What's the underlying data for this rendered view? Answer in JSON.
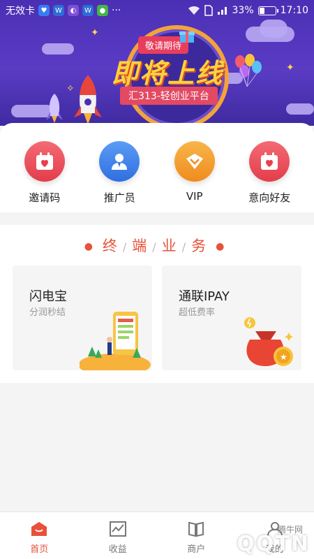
{
  "status_bar": {
    "carrier": "无效卡",
    "battery": "33%",
    "time": "17:10",
    "battery_level": 0.33
  },
  "banner": {
    "tag": "敬请期待",
    "title": "即将上线",
    "subtitle": "汇313-轻创业平台"
  },
  "quick_menu": [
    {
      "label": "邀请码",
      "icon": "calendar-heart-icon",
      "color": "#e8404e"
    },
    {
      "label": "推广员",
      "icon": "user-icon",
      "color": "#3d7fe6"
    },
    {
      "label": "VIP",
      "icon": "diamond-chevron-icon",
      "color": "#f39a2b"
    },
    {
      "label": "意向好友",
      "icon": "calendar-heart-icon",
      "color": "#e8404e"
    }
  ],
  "business": {
    "title_chars": [
      "终",
      "端",
      "业",
      "务"
    ],
    "cards": [
      {
        "title": "闪电宝",
        "subtitle": "分润秒结"
      },
      {
        "title": "通联IPAY",
        "subtitle": "超低费率"
      }
    ]
  },
  "tabbar": {
    "tabs": [
      {
        "label": "首页",
        "icon": "home-icon",
        "active": true
      },
      {
        "label": "收益",
        "icon": "chart-icon",
        "active": false
      },
      {
        "label": "商户",
        "icon": "book-icon",
        "active": false
      },
      {
        "label": "我的",
        "icon": "profile-icon",
        "active": false
      }
    ]
  },
  "watermark": {
    "text": "QQTN",
    "small": "腾牛网"
  }
}
